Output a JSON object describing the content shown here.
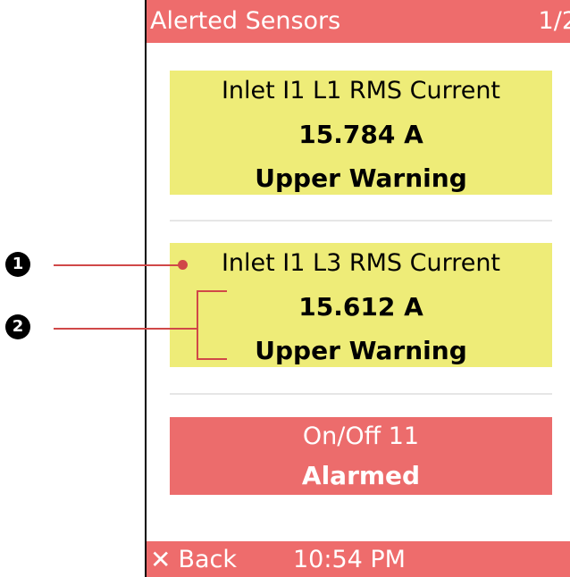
{
  "header": {
    "title": "Alerted Sensors",
    "page": "1/2"
  },
  "sensors": [
    {
      "name": "Inlet I1 L1 RMS Current",
      "value": "15.784 A",
      "state": "Upper Warning",
      "status": "warning"
    },
    {
      "name": "Inlet I1 L3 RMS Current",
      "value": "15.612 A",
      "state": "Upper Warning",
      "status": "warning"
    },
    {
      "name": "On/Off 11",
      "value": "",
      "state": "Alarmed",
      "status": "alarm"
    }
  ],
  "footer": {
    "back_icon": "close-x-icon",
    "back_label": "Back",
    "time": "10:54 PM"
  },
  "callouts": [
    "❶",
    "❷"
  ],
  "colors": {
    "header": "#ee6c6c",
    "warning": "#eeec78",
    "alarm": "#ec6c6c",
    "callout_line": "#d04848"
  }
}
